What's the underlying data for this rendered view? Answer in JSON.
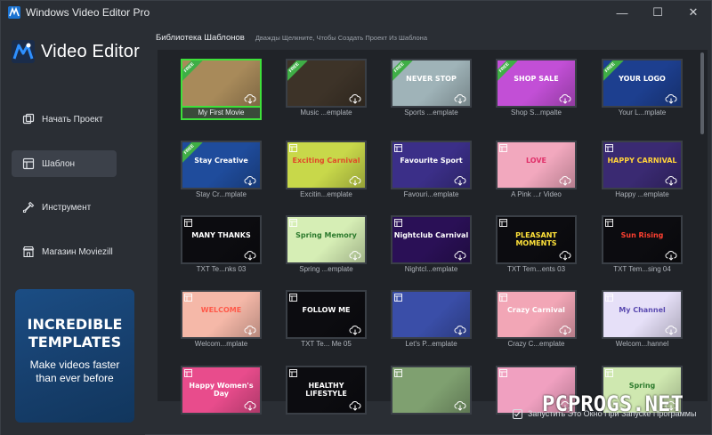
{
  "window": {
    "title": "Windows Video Editor Pro",
    "minimize": "—",
    "maximize": "☐",
    "close": "✕"
  },
  "sidebar": {
    "brand": "Video Editor",
    "items": [
      {
        "label": "Начать Проект",
        "icon": "project-icon",
        "active": false
      },
      {
        "label": "Шаблон",
        "icon": "template-icon",
        "active": true
      },
      {
        "label": "Инструмент",
        "icon": "tool-icon",
        "active": false
      },
      {
        "label": "Магазин Moviezill",
        "icon": "store-icon",
        "active": false
      }
    ],
    "promo": {
      "title_line1": "INCREDIBLE",
      "title_line2": "TEMPLATES",
      "sub_line1": "Make videos faster",
      "sub_line2": "than ever before"
    }
  },
  "library": {
    "title": "Библиотека Шаблонов",
    "hint": "Дважды Щелкните, Чтобы Создать Проект Из Шаблона",
    "cards": [
      {
        "label": "My First Movie",
        "art": "",
        "free": true,
        "selected": true,
        "bg": "#a88a5a"
      },
      {
        "label": "Music ...emplate",
        "art": "",
        "free": true,
        "bg": "#3d3328"
      },
      {
        "label": "Sports ...emplate",
        "art": "NEVER STOP",
        "free": true,
        "bg": "#9fb3b8"
      },
      {
        "label": "Shop S...mpalte",
        "art": "SHOP SALE",
        "free": true,
        "bg": "#c24fd6"
      },
      {
        "label": "Your L...mplate",
        "art": "YOUR LOGO",
        "free": true,
        "bg": "#1d3f8f"
      },
      {
        "label": "Stay Cr...mplate",
        "art": "Stay Creative",
        "free": true,
        "bg": "#1f4c9c"
      },
      {
        "label": "Excitin...emplate",
        "art": "Exciting Carnival",
        "free": false,
        "bg": "#c8d84a"
      },
      {
        "label": "Favouri...emplate",
        "art": "Favourite Sport",
        "free": false,
        "bg": "#3b2f88"
      },
      {
        "label": "A Pink ...r Video",
        "art": "LOVE",
        "free": false,
        "bg": "#f2a8be"
      },
      {
        "label": "Happy ...emplate",
        "art": "HAPPY CARNIVAL",
        "free": false,
        "bg": "#3a2a72"
      },
      {
        "label": "TXT Te...nks 03",
        "art": "MANY THANKS",
        "free": false,
        "bg": "#0c0c10"
      },
      {
        "label": "Spring ...emplate",
        "art": "Spring Memory",
        "free": false,
        "bg": "#d6eeb5"
      },
      {
        "label": "Nightcl...emplate",
        "art": "Nightclub Carnival",
        "free": false,
        "bg": "#2a1056"
      },
      {
        "label": "TXT Tem...ents 03",
        "art": "PLEASANT MOMENTS",
        "free": false,
        "bg": "#0c0c10"
      },
      {
        "label": "TXT Tem...sing 04",
        "art": "Sun Rising",
        "free": false,
        "bg": "#0c0c10"
      },
      {
        "label": "Welcom...mplate",
        "art": "WELCOME",
        "free": false,
        "bg": "#f5b8a8"
      },
      {
        "label": "TXT Te... Me 05",
        "art": "FOLLOW ME",
        "free": false,
        "bg": "#0c0c10"
      },
      {
        "label": "Let's P...emplate",
        "art": "",
        "free": false,
        "bg": "#3a4ea8"
      },
      {
        "label": "Crazy C...emplate",
        "art": "Crazy Carnival",
        "free": false,
        "bg": "#f2a6b6"
      },
      {
        "label": "Welcom...hannel",
        "art": "My Channel",
        "free": false,
        "bg": "#e6e0f8"
      },
      {
        "label": "",
        "art": "Happy Women's Day",
        "free": false,
        "bg": "#e84c8c"
      },
      {
        "label": "",
        "art": "HEALTHY LIFESTYLE",
        "free": false,
        "bg": "#0c0c10"
      },
      {
        "label": "",
        "art": "",
        "free": false,
        "bg": "#7fa070"
      },
      {
        "label": "",
        "art": "",
        "free": false,
        "bg": "#f0a0c0"
      },
      {
        "label": "",
        "art": "Spring",
        "free": false,
        "bg": "#cfe8b0"
      }
    ]
  },
  "footer": {
    "checkbox_label": "Запустить Это Окно При Запуске Программы",
    "checked": true
  },
  "watermark": "PCPROGS.NET"
}
